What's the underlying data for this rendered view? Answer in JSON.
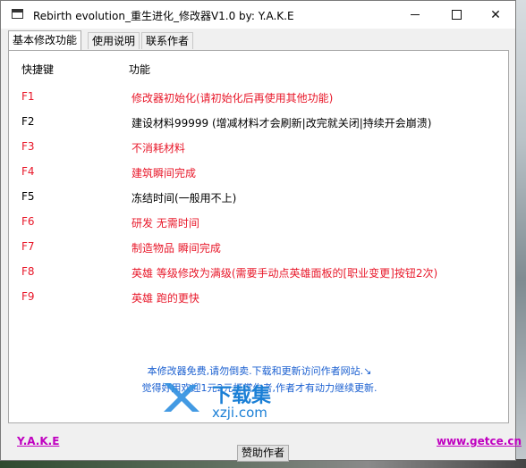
{
  "window": {
    "title": "Rebirth evolution_重生进化_修改器V1.0 by: Y.A.K.E"
  },
  "controls": {
    "minimize": "",
    "maximize": "",
    "close": "✕"
  },
  "tabs": [
    {
      "label": "基本修改功能"
    },
    {
      "label": "使用说明"
    },
    {
      "label": "联系作者"
    }
  ],
  "table": {
    "headers": {
      "key": "快捷键",
      "function": "功能"
    },
    "rows": [
      {
        "key": "F1",
        "function": "修改器初始化(请初始化后再使用其他功能)",
        "color": "#e8182a"
      },
      {
        "key": "F2",
        "function": "建设材料99999 (增减材料才会刷新|改完就关闭|持续开会崩溃)",
        "color": "#000000"
      },
      {
        "key": "F3",
        "function": "不消耗材料",
        "color": "#e8182a"
      },
      {
        "key": "F4",
        "function": "建筑瞬间完成",
        "color": "#e8182a"
      },
      {
        "key": "F5",
        "function": "冻结时间(一般用不上)",
        "color": "#000000"
      },
      {
        "key": "F6",
        "function": "研发 无需时间",
        "color": "#e8182a"
      },
      {
        "key": "F7",
        "function": "制造物品 瞬间完成",
        "color": "#e8182a"
      },
      {
        "key": "F8",
        "function": "英雄 等级修改为满级(需要手动点英雄面板的[职业变更]按钮2次)",
        "color": "#e8182a"
      },
      {
        "key": "F9",
        "function": "英雄 跑的更快",
        "color": "#e8182a"
      }
    ]
  },
  "notice": {
    "line1": "本修改器免费,请勿倒卖.下载和更新访问作者网站.↘",
    "line2": "觉得好用欢迎1元2元打赏作者,作者才有动力继续更新."
  },
  "watermark": {
    "line1": "下载集",
    "line2": "xzji.com"
  },
  "footer": {
    "author": "Y.A.K.E",
    "donate": "赞助作者",
    "website": "www.getce.cn"
  }
}
